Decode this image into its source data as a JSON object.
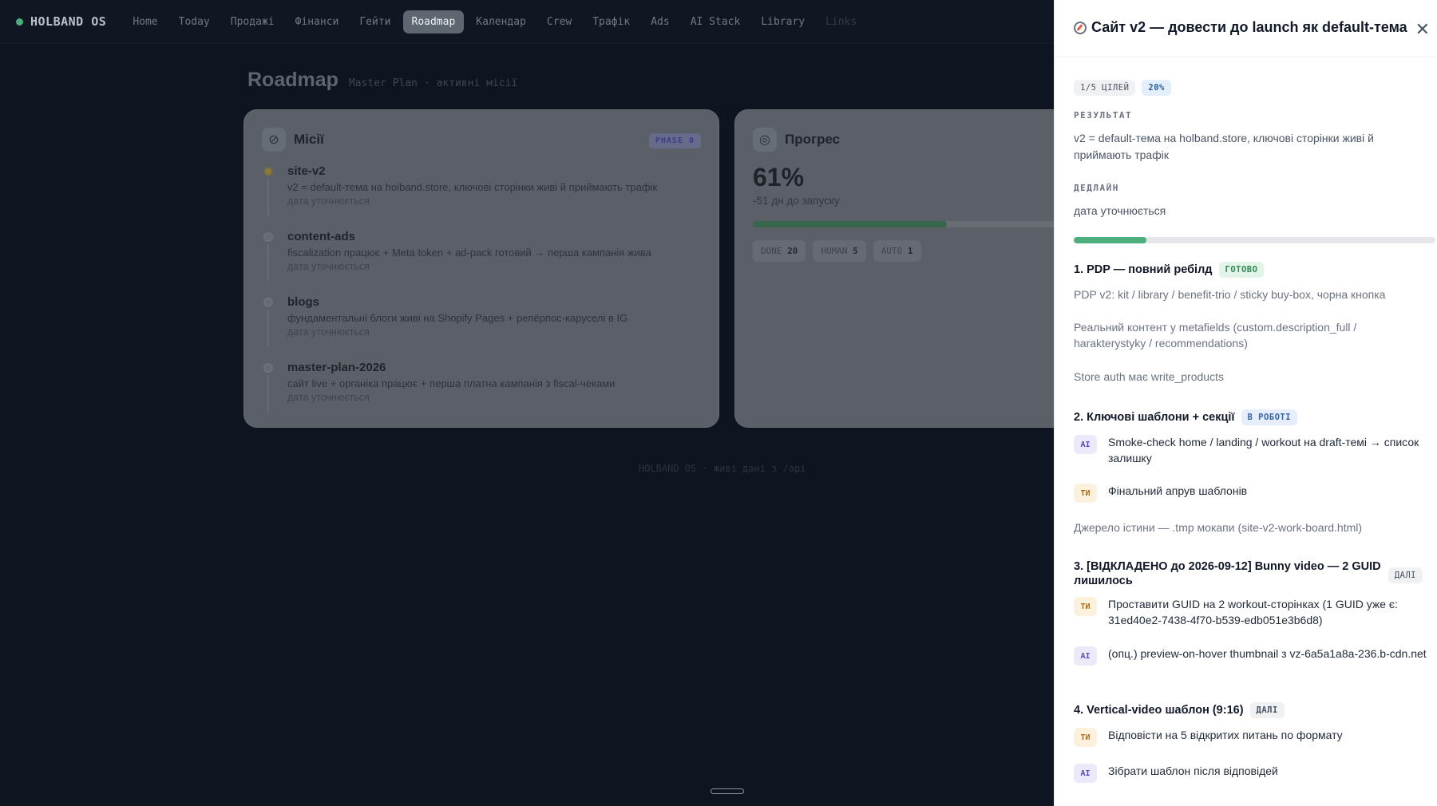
{
  "app": {
    "brand": "HOLBAND OS",
    "nav": [
      "Home",
      "Today",
      "Продажі",
      "Фінанси",
      "Гейти",
      "Roadmap",
      "Календар",
      "Crew",
      "Трафік",
      "Ads",
      "AI Stack",
      "Library",
      "Links"
    ],
    "active_nav": "Roadmap",
    "page_title": "Roadmap",
    "page_subtitle": "Master Plan · активні місії",
    "footer_note": "HOLBAND OS · живі дані з /api"
  },
  "missions_card": {
    "title": "Місії",
    "phase_badge": "PHASE 0",
    "missions": [
      {
        "name": "site-v2",
        "desc": "v2 = default-тема на holband.store, ключові сторінки живі й приймають трафік",
        "date": "дата уточнюється"
      },
      {
        "name": "content-ads",
        "desc": "fiscalization працює + Meta token + ad-pack готовий → перша кампанія жива",
        "date": "дата уточнюється"
      },
      {
        "name": "blogs",
        "desc": "фундаментальні блоги живі на Shopify Pages + репёрпос-каруселі в IG",
        "date": "дата уточнюється"
      },
      {
        "name": "master-plan-2026",
        "desc": "сайт live + органіка працює + перша платна кампанія з fiscal-чеками",
        "date": "дата уточнюється"
      }
    ]
  },
  "progress_card": {
    "title": "Прогрес",
    "percent_text": "61%",
    "progress_fraction": 0.61,
    "subtitle": "-51 дн до запуску",
    "stats": [
      {
        "label": "DONE",
        "value": "20"
      },
      {
        "label": "HUMAN",
        "value": "5"
      },
      {
        "label": "AUTO",
        "value": "1"
      }
    ]
  },
  "drawer": {
    "title": "Сайт v2 — довести до launch як default-тема",
    "close": "✕",
    "goals_badge": "1/5 ЦІЛЕЙ",
    "percent_badge": "20%",
    "progress_fraction": 0.2,
    "result_label": "РЕЗУЛЬТАТ",
    "result_text": "v2 = default-тема на holband.store, ключові сторінки живі й приймають трафік",
    "deadline_label": "ДЕДЛАЙН",
    "deadline_text": "дата уточнюється",
    "goals": [
      {
        "title": "1. PDP — повний ребілд",
        "status": "ГОТОВО",
        "items": [
          "PDP v2: kit / library / benefit-trio / sticky buy-box, чорна кнопка",
          "Реальний контент у metafields (custom.description_full / harakterystyky / recommendations)",
          "Store auth має write_products"
        ]
      },
      {
        "title": "2. Ключові шаблони + секції",
        "status": "В РОБОТІ",
        "tasks": [
          {
            "who": "AI",
            "text": "Smoke-check home / landing / workout на draft-темі → список залишку"
          },
          {
            "who": "ТИ",
            "text": "Фінальний апрув шаблонів"
          }
        ],
        "note": "Джерело істини — .tmp мокапи (site-v2-work-board.html)"
      },
      {
        "title": "3. [ВІДКЛАДЕНО до 2026-09-12] Bunny video — 2 GUID лишилось",
        "status": "ДАЛІ",
        "tasks": [
          {
            "who": "ТИ",
            "text": "Проставити GUID на 2 workout-сторінках (1 GUID уже є: 31ed40e2-7438-4f70-b539-edb051e3b6d8)"
          },
          {
            "who": "AI",
            "text": "(опц.) preview-on-hover thumbnail з vz-6a5a1a8a-236.b-cdn.net"
          }
        ]
      },
      {
        "title": "4. Vertical-video шаблон (9:16)",
        "status": "ДАЛІ",
        "tasks": [
          {
            "who": "ТИ",
            "text": "Відповісти на 5 відкритих питань по формату"
          },
          {
            "who": "AI",
            "text": "Зібрати шаблон після відповідей"
          }
        ]
      }
    ]
  }
}
